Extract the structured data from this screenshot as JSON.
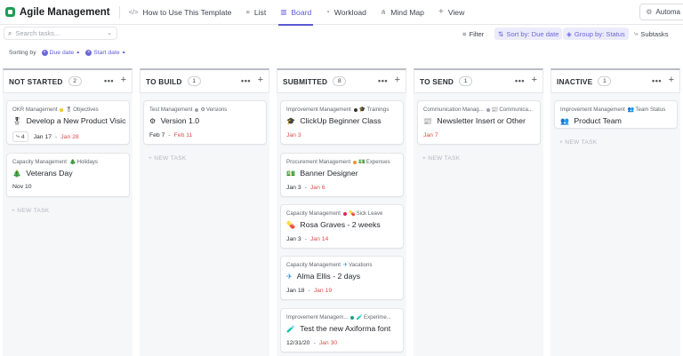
{
  "app": {
    "title": "Agile Management"
  },
  "nav": {
    "tabs": [
      {
        "icon": "</>",
        "label": "How to Use This Template"
      },
      {
        "icon": "≡",
        "label": "List"
      },
      {
        "icon": "▥",
        "label": "Board"
      },
      {
        "icon": "◔",
        "label": "Workload"
      },
      {
        "icon": "⋔",
        "label": "Mind Map"
      },
      {
        "icon": "+",
        "label": "View"
      }
    ],
    "automate_label": "Automa"
  },
  "toolbar": {
    "search_placeholder": "Search tasks...",
    "filter_label": "Filter",
    "sort_label": "Sort by: Due date",
    "group_label": "Group by: Status",
    "subtasks_label": "Subtasks"
  },
  "sorting": {
    "label": "Sorting by",
    "chips": [
      "Due date",
      "Start date"
    ]
  },
  "new_task_label": "+ NEW TASK",
  "colors": {
    "accent": "#5b5bd6",
    "due_red": "#e04b4b",
    "brand_green": "#1f9d55"
  },
  "columns": [
    {
      "title": "NOT STARTED",
      "count": "2",
      "cards": [
        {
          "list": "OKR Management",
          "dot": "#f5c518",
          "tag_icon": "🎖",
          "tag": "Objectives",
          "emoji": "🎖",
          "title": "Develop a New Product Vision",
          "subtasks": "4",
          "start": "Jan 17",
          "due": "Jan 28"
        },
        {
          "list": "Capacity Management",
          "dot": "",
          "tag_icon": "🎄",
          "tag": "Holidays",
          "emoji": "🎄",
          "title": "Veterans Day",
          "start": "Nov 10",
          "due": ""
        }
      ]
    },
    {
      "title": "TO BUILD",
      "count": "1",
      "cards": [
        {
          "list": "Test Management",
          "dot": "#9aa0a8",
          "tag_icon": "⚙",
          "tag": "Versions",
          "emoji": "⚙",
          "title": "Version 1.0",
          "start": "Feb 7",
          "due": "Feb 11"
        }
      ]
    },
    {
      "title": "SUBMITTED",
      "count": "8",
      "cards": [
        {
          "list": "Improvement Management",
          "dot": "#333333",
          "tag_icon": "🎓",
          "tag": "Trainings",
          "emoji": "🎓",
          "title": "ClickUp Beginner Class",
          "start": "",
          "due": "Jan 3"
        },
        {
          "list": "Procurement Management",
          "dot": "#f0902a",
          "tag_icon": "💵",
          "tag": "Expenses",
          "emoji": "💵",
          "title": "Banner Designer",
          "start": "Jan 3",
          "due": "Jan 6"
        },
        {
          "list": "Capacity Management",
          "dot": "#e0245e",
          "tag_icon": "💊",
          "tag": "Sick Leave",
          "emoji": "💊",
          "title": "Rosa Graves - 2 weeks",
          "start": "Jan 3",
          "due": "Jan 14"
        },
        {
          "list": "Capacity Management",
          "dot": "",
          "tag_icon": "✈",
          "tag": "Vacations",
          "emoji": "✈",
          "title": "Alma Ellis - 2 days",
          "start": "Jan 18",
          "due": "Jan 19"
        },
        {
          "list": "Improvement Managem...",
          "dot": "#1f9d80",
          "tag_icon": "🧪",
          "tag": "Experime...",
          "emoji": "🧪",
          "title": "Test the new Axiforma font",
          "start": "12/31/20",
          "due": "Jan 30"
        }
      ]
    },
    {
      "title": "TO SEND",
      "count": "1",
      "cards": [
        {
          "list": "Communication Manag...",
          "dot": "#9aa0a8",
          "tag_icon": "📰",
          "tag": "Communica...",
          "emoji": "📰",
          "title": "Newsletter Insert or Other",
          "start": "",
          "due": "Jan 7"
        }
      ]
    },
    {
      "title": "INACTIVE",
      "count": "1",
      "cards": [
        {
          "list": "Improvement Management",
          "dot": "",
          "tag_icon": "👥",
          "tag": "Team Status",
          "emoji": "👥",
          "title": "Product Team",
          "start": "",
          "due": ""
        }
      ]
    }
  ]
}
